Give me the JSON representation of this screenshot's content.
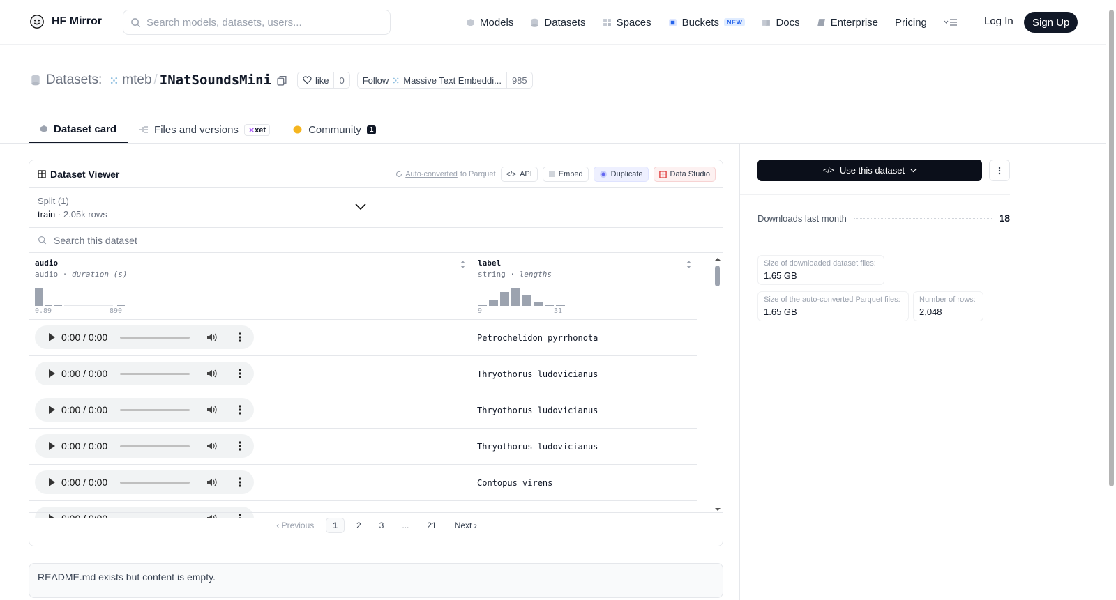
{
  "header": {
    "brand": "HF Mirror",
    "search_placeholder": "Search models, datasets, users...",
    "nav": [
      {
        "label": "Models",
        "icon": "models-icon"
      },
      {
        "label": "Datasets",
        "icon": "datasets-icon"
      },
      {
        "label": "Spaces",
        "icon": "spaces-icon"
      },
      {
        "label": "Buckets",
        "icon": "buckets-icon",
        "badge": "NEW"
      },
      {
        "label": "Docs",
        "icon": "docs-icon"
      },
      {
        "label": "Enterprise",
        "icon": "enterprise-icon"
      },
      {
        "label": "Pricing"
      }
    ],
    "login": "Log In",
    "signup": "Sign Up"
  },
  "title": {
    "prefix": "Datasets:",
    "org": "mteb",
    "separator": "/",
    "name": "INatSoundsMini",
    "like_label": "like",
    "like_count": "0",
    "follow_label": "Follow",
    "follow_org": "Massive Text Embeddi...",
    "follow_count": "985"
  },
  "tabs": [
    {
      "label": "Dataset card",
      "active": true
    },
    {
      "label": "Files and versions",
      "badge": "xet"
    },
    {
      "label": "Community",
      "count": "1"
    }
  ],
  "viewer": {
    "title": "Dataset Viewer",
    "auto_converted": "Auto-converted",
    "auto_converted_suffix": "to Parquet",
    "api": "API",
    "embed": "Embed",
    "duplicate": "Duplicate",
    "data_studio": "Data Studio",
    "split_label": "Split (1)",
    "split_name": "train",
    "split_rows": "2.05k rows",
    "search_placeholder": "Search this dataset",
    "columns": [
      {
        "name": "audio",
        "type": "audio",
        "stat": "duration (s)",
        "min": "0.89",
        "max": "890"
      },
      {
        "name": "label",
        "type": "string",
        "stat": "lengths",
        "min": "9",
        "max": "31"
      }
    ],
    "player_time": "0:00 / 0:00",
    "rows": [
      {
        "label": "Petrochelidon pyrrhonota"
      },
      {
        "label": "Thryothorus ludovicianus"
      },
      {
        "label": "Thryothorus ludovicianus"
      },
      {
        "label": "Thryothorus ludovicianus"
      },
      {
        "label": "Contopus virens"
      }
    ],
    "pager": {
      "previous": "Previous",
      "pages": [
        "1",
        "2",
        "3",
        "...",
        "21"
      ],
      "current": "1",
      "next": "Next"
    }
  },
  "readme_text": "README.md exists but content is empty.",
  "sidebar": {
    "use_button": "Use this dataset",
    "downloads_label": "Downloads last month",
    "downloads_value": "18",
    "stats": [
      {
        "label": "Size of downloaded dataset files:",
        "value": "1.65 GB"
      },
      {
        "label": "Size of the auto-converted Parquet files:",
        "value": "1.65 GB"
      },
      {
        "label": "Number of rows:",
        "value": "2,048"
      }
    ]
  },
  "colors": {
    "primary_dark": "#111827",
    "muted": "#6b7280",
    "border": "#e5e7eb",
    "histogram": "#9ca3af",
    "accent_blue": "#2563eb"
  }
}
